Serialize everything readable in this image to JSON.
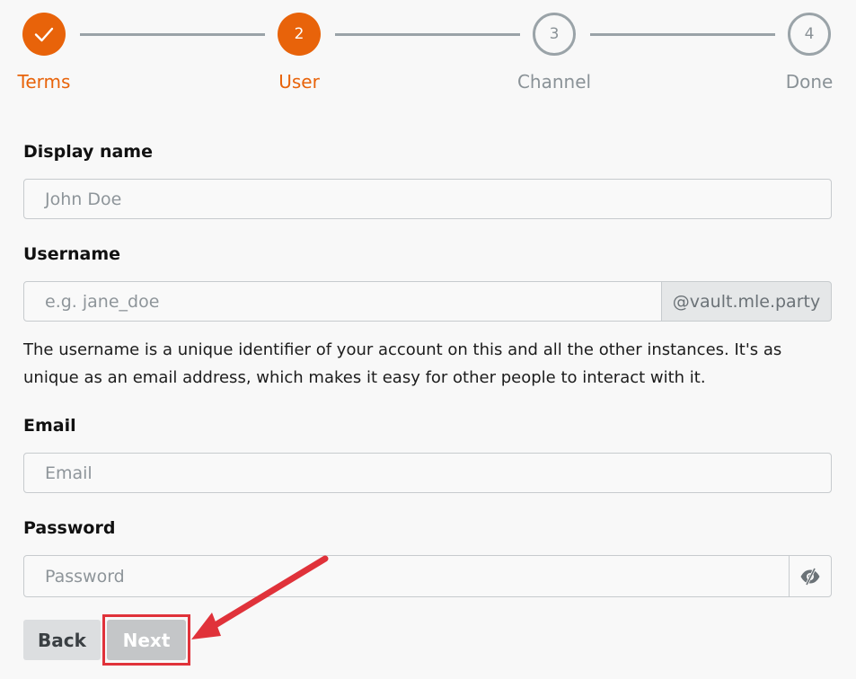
{
  "stepper": {
    "steps": [
      {
        "label": "Terms",
        "number": "",
        "state": "done"
      },
      {
        "label": "User",
        "number": "2",
        "state": "active"
      },
      {
        "label": "Channel",
        "number": "3",
        "state": "pending"
      },
      {
        "label": "Done",
        "number": "4",
        "state": "pending"
      }
    ]
  },
  "form": {
    "display_name": {
      "label": "Display name",
      "placeholder": "John Doe"
    },
    "username": {
      "label": "Username",
      "placeholder": "e.g. jane_doe",
      "suffix": "@vault.mle.party",
      "help": "The username is a unique identifier of your account on this and all the other instances. It's as unique as an email address, which makes it easy for other people to interact with it."
    },
    "email": {
      "label": "Email",
      "placeholder": "Email"
    },
    "password": {
      "label": "Password",
      "placeholder": "Password"
    }
  },
  "actions": {
    "back_label": "Back",
    "next_label": "Next"
  },
  "colors": {
    "accent": "#e8630a",
    "annotation": "#e0323a"
  }
}
